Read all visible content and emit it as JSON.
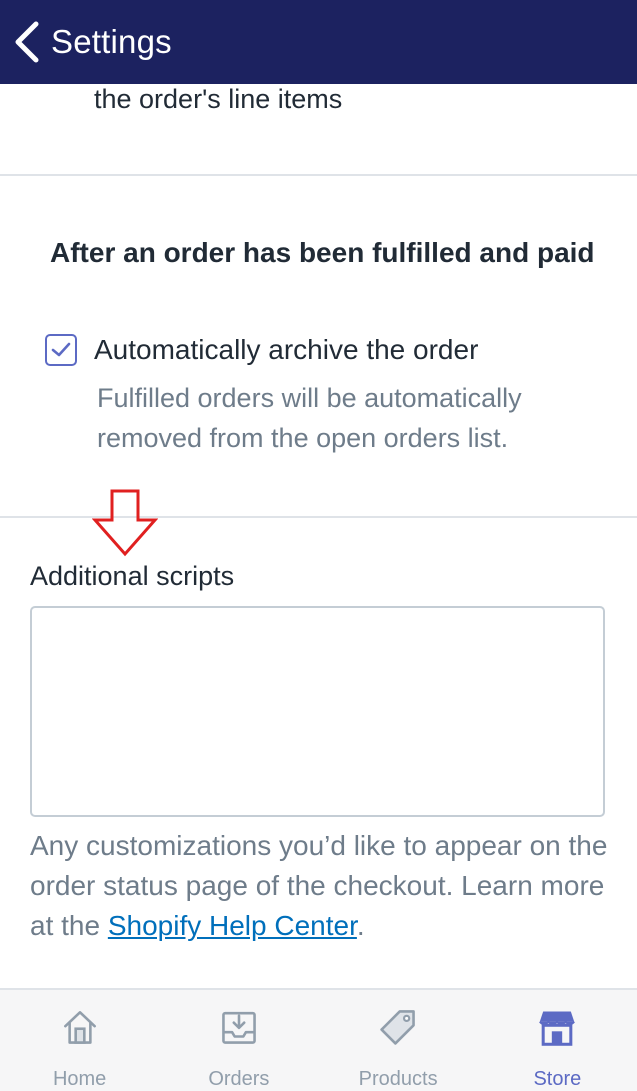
{
  "header": {
    "title": "Settings",
    "background_color": "#1c2260"
  },
  "previous_section": {
    "text": "the order's line items"
  },
  "archive_section": {
    "heading": "After an order has been fulfilled and paid",
    "checkbox_label": "Automatically archive the order",
    "checkbox_checked": true,
    "help_text": "Fulfilled orders will be automatically removed from the open orders list."
  },
  "scripts_section": {
    "label": "Additional scripts",
    "value": "",
    "help_prefix": "Any customizations you’d like to appear on the order status page of the checkout. Learn more at the ",
    "help_link": "Shopify Help Center",
    "help_suffix": "."
  },
  "annotation": {
    "arrow_color": "#e02020"
  },
  "tabbar": {
    "tabs": [
      {
        "label": "Home",
        "icon": "home-icon",
        "active": false
      },
      {
        "label": "Orders",
        "icon": "orders-icon",
        "active": false
      },
      {
        "label": "Products",
        "icon": "products-tag-icon",
        "active": false
      },
      {
        "label": "Store",
        "icon": "store-icon",
        "active": true
      }
    ],
    "active_color": "#5c6ac4",
    "inactive_color": "#919eab"
  }
}
